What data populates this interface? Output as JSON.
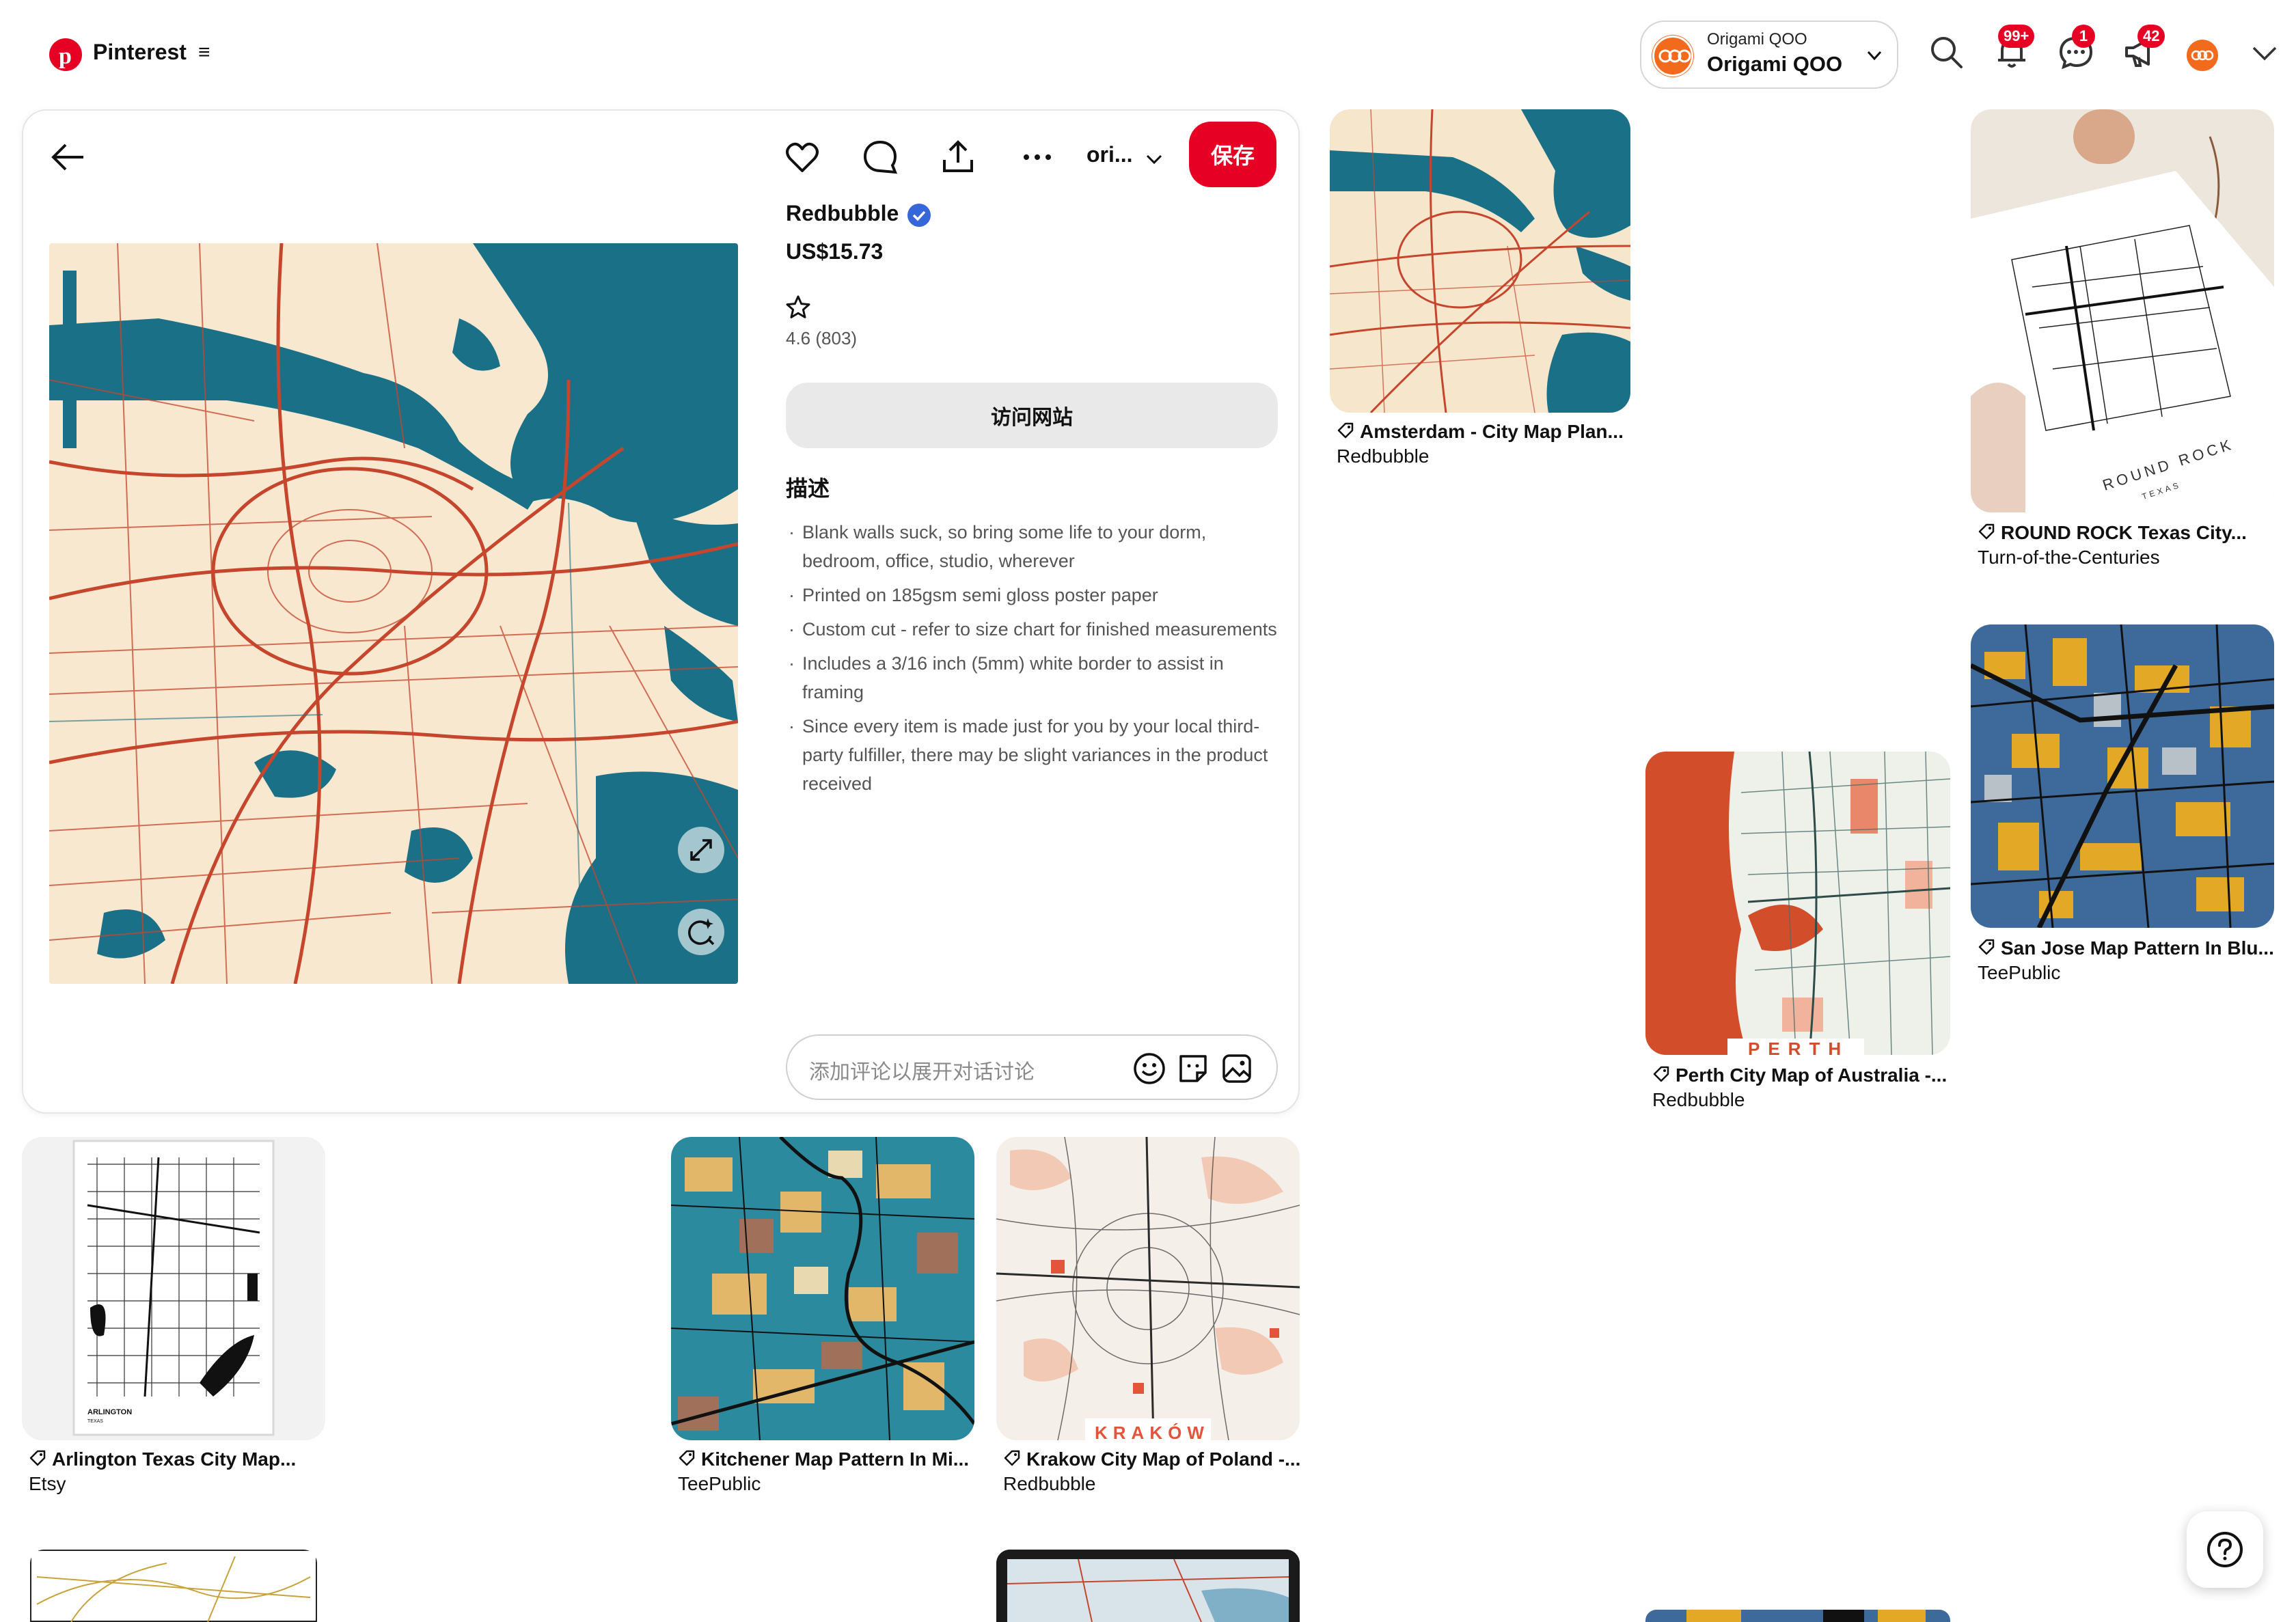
{
  "header": {
    "logo_text": "Pinterest",
    "menu_icon": "hamburger-icon",
    "account_small": "Origami QOO",
    "account_big": "Origami QOO",
    "notifications_badge": "99+",
    "messages_badge": "1",
    "updates_badge": "42"
  },
  "pin": {
    "board_label": "ori...",
    "save_label": "保存",
    "seller": "Redbubble",
    "price": "US$15.73",
    "rating": "4.6 (803)",
    "visit_label": "访问网站",
    "description_title": "描述",
    "description_items": [
      "Blank walls suck, so bring some life to your dorm, bedroom, office, studio, wherever",
      "Printed on 185gsm semi gloss poster paper",
      "Custom cut - refer to size chart for finished measurements",
      "Includes a 3/16 inch (5mm) white border to assist in framing",
      "Since every item is made just for you by your local third-party fulfiller, there may be slight variances in the product received"
    ],
    "comment_placeholder": "添加评论以展开对话讨论"
  },
  "grid": [
    {
      "title": "Amsterdam - City Map Plan...",
      "source": "Redbubble"
    },
    {
      "title": "ROUND ROCK Texas City...",
      "source": "Turn-of-the-Centuries"
    },
    {
      "title": "San Jose Map Pattern In Blu...",
      "source": "TeePublic"
    },
    {
      "title": "Perth City Map of Australia -...",
      "source": "Redbubble"
    },
    {
      "title": "Arlington Texas City Map...",
      "source": "Etsy"
    },
    {
      "title": "Kitchener Map Pattern In Mi...",
      "source": "TeePublic"
    },
    {
      "title": "Krakow City Map of Poland -...",
      "source": "Redbubble"
    }
  ],
  "image_labels": {
    "round_rock": "ROUND ROCK",
    "texas": "TEXAS",
    "perth": "PERTH",
    "krakow": "KRAKÓW",
    "arlington": "ARLINGTON",
    "arlington_sub": "TEXAS"
  },
  "colors": {
    "brand_red": "#e60023",
    "verified_blue": "#3766d9",
    "map_cream": "#f7e8cf",
    "map_teal": "#1a7187",
    "map_red": "#c6452d"
  }
}
